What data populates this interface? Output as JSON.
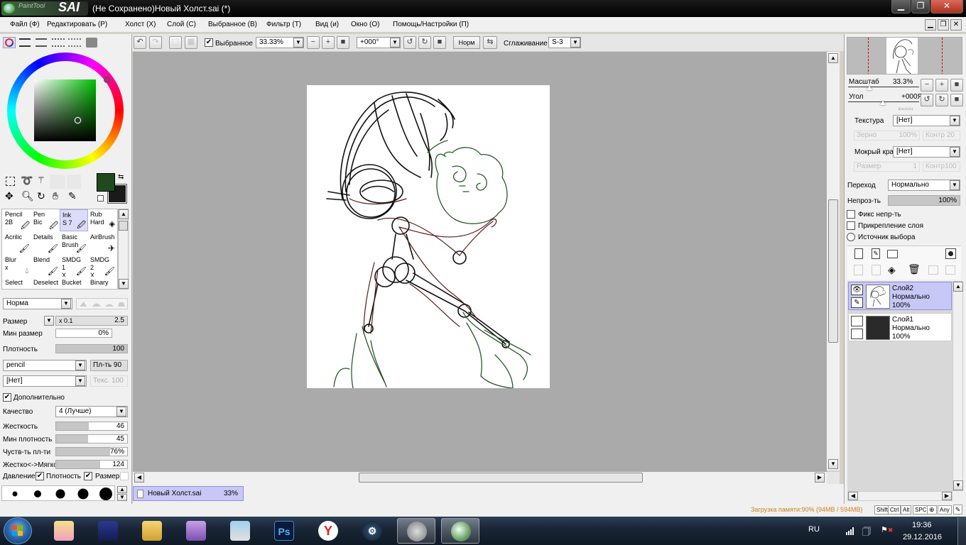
{
  "title": {
    "app_logo_small": "PaintTool",
    "app_logo_big": "SAI",
    "window": "(Не Сохранено)Новый Холст.sai (*)"
  },
  "menu": [
    "Файл (Ф)",
    "Редактировать (Р)",
    "Холст (Х)",
    "Слой (С)",
    "Выбранное (В)",
    "Фильтр (Т)",
    "Вид (и)",
    "Окно (О)",
    "Помощь/Настройки (П)"
  ],
  "toolbar": {
    "selection_label": "Выбранное",
    "zoom": "33.33%",
    "rotation": "+000°",
    "norm_button": "Норм",
    "smoothing_label": "Сглаживание",
    "smoothing_value": "S-3"
  },
  "brushes": [
    {
      "name": "Pencil",
      "sub": "2B"
    },
    {
      "name": "Pen",
      "sub": "Bic"
    },
    {
      "name": "Ink",
      "sub": "S 7"
    },
    {
      "name": "Rub",
      "sub": "Hard"
    },
    {
      "name": "Acrilic",
      "sub": ""
    },
    {
      "name": "Details",
      "sub": ""
    },
    {
      "name": "Basic",
      "sub": "Brush"
    },
    {
      "name": "AirBrush",
      "sub": ""
    },
    {
      "name": "Blur",
      "sub": "x"
    },
    {
      "name": "Blend",
      "sub": ""
    },
    {
      "name": "SMDG 1",
      "sub": "X"
    },
    {
      "name": "SMDG 2",
      "sub": "X"
    },
    {
      "name": "Select",
      "sub": ""
    },
    {
      "name": "Deselect",
      "sub": ""
    },
    {
      "name": "Bucket",
      "sub": ""
    },
    {
      "name": "Binary",
      "sub": ""
    }
  ],
  "brush_settings": {
    "blend_mode": "Норма",
    "size_label": "Размер",
    "size_mult": "x 0.1",
    "size_value": "2.5",
    "min_size_label": "Мин размер",
    "min_size_value": "0%",
    "density_label": "Плотность",
    "density_value": "100",
    "density_fill": 1.0,
    "shape": "pencil",
    "shape_strength": "Пл-ть 90",
    "texture": "[Нет]",
    "texture_strength": "Текс. 100",
    "advanced_label": "Дополнительно",
    "quality_label": "Качество",
    "quality_value": "4 (Лучше)",
    "hardness_label": "Жесткость",
    "hardness_value": "46",
    "hardness_fill": 0.46,
    "min_density_label": "Мин плотность",
    "min_density_value": "45",
    "min_density_fill": 0.45,
    "sensitivity_label": "Чуств-ть пл-ти",
    "sensitivity_value": "76%",
    "sensitivity_fill": 0.76,
    "hardsoft_label": "Жестко<->Мягко",
    "hardsoft_value": "124",
    "hardsoft_fill": 0.62,
    "pressure_label": "Давление:",
    "pressure_density": "Плотность",
    "pressure_size": "Размер"
  },
  "navigator": {
    "zoom_label": "Масштаб",
    "zoom_value": "33.3%",
    "zoom_fill": 0.33,
    "angle_label": "Угол",
    "angle_value": "+000Я",
    "angle_fill": 0.5
  },
  "paper": {
    "texture_label": "Текстура",
    "texture_value": "[Нет]",
    "grain_label": "Зерно",
    "grain_value": "100%",
    "contrast_label": "Контр",
    "contrast_value": "20",
    "wet_label": "Мокрый край",
    "wet_value": "[Нет]",
    "wsize_label": "Размер",
    "wsize_value": "1",
    "wcontrast_label": "Контр",
    "wcontrast_value": "100"
  },
  "layer_props": {
    "blend_label": "Переход",
    "blend_value": "Нормально",
    "opacity_label": "Непроз-ть",
    "opacity_value": "100%",
    "opacity_fill": 1.0,
    "preserve_opacity": "Фикс непр-ть",
    "clipping": "Прикрепление слоя",
    "selection_source": "Источник выбора"
  },
  "layers": [
    {
      "name": "Слой2",
      "mode": "Нормально",
      "opacity": "100%"
    },
    {
      "name": "Слой1",
      "mode": "Нормально",
      "opacity": "100%"
    }
  ],
  "doc_tab": {
    "name": "Новый Холст.sai",
    "zoom": "33%"
  },
  "status": {
    "memory": "Загрузка памяти:90% (94MB / 594MB)",
    "keys": [
      "Shift",
      "Ctrl",
      "Alt",
      "SPC",
      "⊕",
      "Any"
    ]
  },
  "taskbar": {
    "lang": "RU",
    "time": "19:36",
    "date": "29.12.2016"
  },
  "colors": {
    "primary": "#1e4a1e",
    "secondary": "#1a1a1a",
    "sketch_black": "#111111",
    "sketch_red": "#5a1a1a",
    "sketch_green": "#2a5a2a"
  }
}
